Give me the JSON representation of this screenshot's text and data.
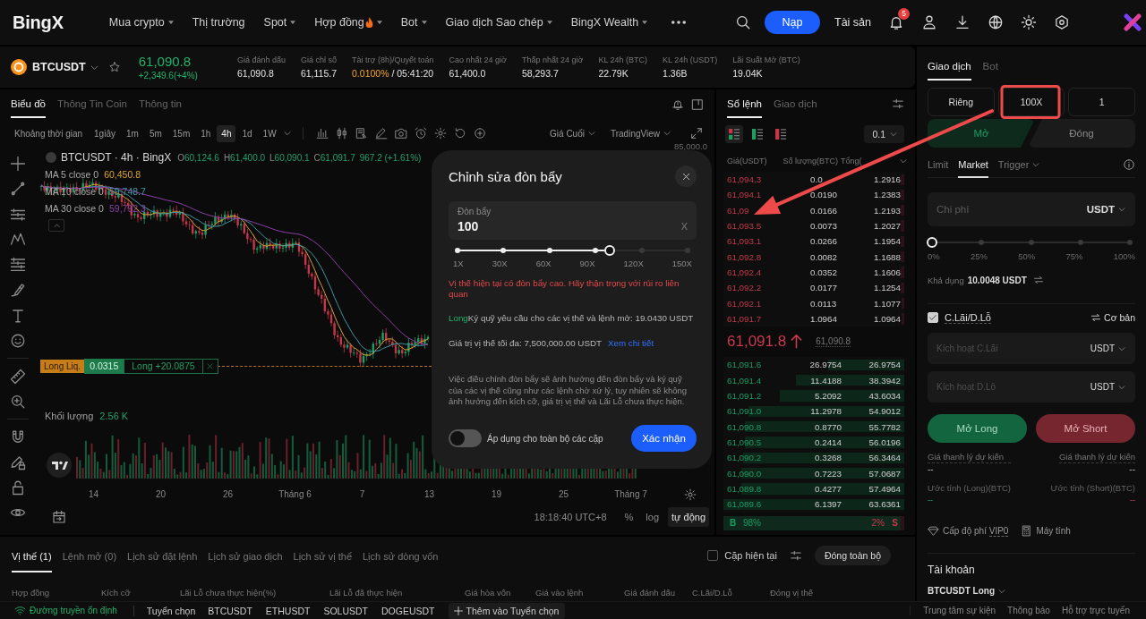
{
  "nav": {
    "logo": "BingX",
    "menu": [
      {
        "label": "Mua crypto",
        "hot": false,
        "dropdown": true
      },
      {
        "label": "Thị trường",
        "hot": false,
        "dropdown": false
      },
      {
        "label": "Spot",
        "hot": false,
        "dropdown": true
      },
      {
        "label": "Hợp đồng",
        "hot": true,
        "dropdown": true
      },
      {
        "label": "Bot",
        "hot": false,
        "dropdown": true
      },
      {
        "label": "Giao dịch Sao chép",
        "hot": false,
        "dropdown": true
      },
      {
        "label": "BingX Wealth",
        "hot": false,
        "dropdown": true
      }
    ],
    "deposit": "Nạp",
    "assets": "Tài sản",
    "notification_count": "5"
  },
  "ticker": {
    "symbol": "BTCUSDT",
    "price": "61,090.8",
    "change": "+2,349.6(+4%)",
    "rising": true,
    "stats": [
      {
        "kind": "plain",
        "label": "Giá đánh dấu",
        "value": "61,090.8"
      },
      {
        "kind": "plain",
        "label": "Giá chỉ số",
        "value": "61,115.7"
      },
      {
        "kind": "funding",
        "label": "Tài trợ (8h)/Quyết toán",
        "value": "0.0100%",
        "suffix": "/ 05:41:20"
      },
      {
        "kind": "plain",
        "label": "Cao nhất 24 giờ",
        "value": "61,400.0"
      },
      {
        "kind": "plain",
        "label": "Thấp nhất 24 giờ",
        "value": "58,293.7"
      },
      {
        "kind": "plain",
        "label": "KL 24h (BTC)",
        "value": "22.79K"
      },
      {
        "kind": "plain",
        "label": "KL 24h (USDT)",
        "value": "1.36B"
      },
      {
        "kind": "plain",
        "label": "Lãi Suất Mở (BTC)",
        "value": "19.04K"
      }
    ]
  },
  "chart": {
    "tabs": [
      {
        "label": "Biểu đồ",
        "selected": true
      },
      {
        "label": "Thông Tin Coin",
        "selected": false
      },
      {
        "label": "Thông tin",
        "selected": false
      }
    ],
    "interval_label": "Khoảng thời gian",
    "intervals": [
      {
        "label": "1giây",
        "selected": false
      },
      {
        "label": "1m",
        "selected": false
      },
      {
        "label": "5m",
        "selected": false
      },
      {
        "label": "15m",
        "selected": false
      },
      {
        "label": "1h",
        "selected": false
      },
      {
        "label": "4h",
        "selected": true
      },
      {
        "label": "1d",
        "selected": false
      },
      {
        "label": "1W",
        "selected": false
      }
    ],
    "price_source": "Giá Cuối",
    "chart_type": "TradingView",
    "price_axis_label": "85,000.0",
    "legend": {
      "title": "BTCUSDT · 4h · BingX",
      "ohlc": [
        {
          "key": "O",
          "value": "60,124.6"
        },
        {
          "key": "H",
          "value": "61,400.0"
        },
        {
          "key": "L",
          "value": "60,090.1"
        },
        {
          "key": "C",
          "value": "61,091.7"
        }
      ],
      "change": "967.2 (+1.61%)"
    },
    "moving_averages": [
      {
        "label": "MA 5 close 0",
        "value": "60,450.8",
        "color": "#d9a234"
      },
      {
        "label": "MA 10 close 0",
        "value": "59,748.7",
        "color": "#3a97a3"
      },
      {
        "label": "MA 30 close 0",
        "value": "59,792.3",
        "color": "#8c3fa6"
      }
    ],
    "position_line": {
      "liquidation": "Long Liq.",
      "size": "0.0315",
      "pnl": "Long +20.0875"
    },
    "volume": {
      "label": "Khối lượng",
      "value": "2.56 K"
    },
    "x_labels": [
      "14",
      "20",
      "26",
      "Tháng 6",
      "7",
      "13",
      "19",
      "25",
      "Tháng 7"
    ],
    "time": "18:18:40 UTC+8",
    "scales": [
      {
        "label": "%",
        "selected": false
      },
      {
        "label": "log",
        "selected": false
      },
      {
        "label": "tự động",
        "selected": true
      }
    ]
  },
  "orderbook": {
    "tabs": [
      {
        "label": "Sổ lệnh",
        "selected": true
      },
      {
        "label": "Giao dịch",
        "selected": false
      }
    ],
    "views": [
      {
        "kind": "both",
        "selected": true
      },
      {
        "kind": "bids",
        "selected": false
      },
      {
        "kind": "asks",
        "selected": false
      }
    ],
    "precision": "0.1",
    "columns": [
      {
        "label": "Giá(USDT)",
        "sortable": false
      },
      {
        "label": "Số lượng(BTC)",
        "sortable": false
      },
      {
        "label": "Tổng(",
        "sortable": true
      }
    ],
    "asks": [
      {
        "price": "61,094.3",
        "qty": "0.0",
        "total": "1.2916",
        "level": 0.02
      },
      {
        "price": "61,094.1",
        "qty": "0.0190",
        "total": "1.2383",
        "level": 0.019
      },
      {
        "price": "61,09",
        "qty": "0.0166",
        "total": "1.2193",
        "level": 0.019
      },
      {
        "price": "61,093.5",
        "qty": "0.0073",
        "total": "1.2027",
        "level": 0.019
      },
      {
        "price": "61,093.1",
        "qty": "0.0266",
        "total": "1.1954",
        "level": 0.019
      },
      {
        "price": "61,092.8",
        "qty": "0.0082",
        "total": "1.1688",
        "level": 0.018
      },
      {
        "price": "61,092.4",
        "qty": "0.0352",
        "total": "1.1606",
        "level": 0.018
      },
      {
        "price": "61,092.2",
        "qty": "0.0177",
        "total": "1.1254",
        "level": 0.018
      },
      {
        "price": "61,092.1",
        "qty": "0.0113",
        "total": "1.1077",
        "level": 0.017
      },
      {
        "price": "61,091.7",
        "qty": "1.0964",
        "total": "1.0964",
        "level": 0.017
      }
    ],
    "last": {
      "price": "61,091.8",
      "rising": true,
      "mark_price": "61,090.8"
    },
    "bids": [
      {
        "price": "61,091.6",
        "qty": "26.9754",
        "total": "26.9754",
        "level": 0.42
      },
      {
        "price": "61,091.4",
        "qty": "11.4188",
        "total": "38.3942",
        "level": 0.6
      },
      {
        "price": "61,091.2",
        "qty": "5.2092",
        "total": "43.6034",
        "level": 0.69
      },
      {
        "price": "61,091.0",
        "qty": "11.2978",
        "total": "54.9012",
        "level": 0.86
      },
      {
        "price": "61,090.8",
        "qty": "0.8770",
        "total": "55.7782",
        "level": 0.88
      },
      {
        "price": "61,090.5",
        "qty": "0.2414",
        "total": "56.0196",
        "level": 0.88
      },
      {
        "price": "61,090.2",
        "qty": "0.3268",
        "total": "56.3464",
        "level": 0.89
      },
      {
        "price": "61,090.0",
        "qty": "0.7223",
        "total": "57.0687",
        "level": 0.9
      },
      {
        "price": "61,089.8",
        "qty": "0.4277",
        "total": "57.4964",
        "level": 0.9
      },
      {
        "price": "61,089.6",
        "qty": "6.1397",
        "total": "63.6361",
        "level": 1
      }
    ],
    "ratio": {
      "buy_label": "B",
      "buy": "98%",
      "sell": "2%",
      "sell_label": "S",
      "level": 0.98
    }
  },
  "modal": {
    "title": "Chỉnh sửa đòn bẩy",
    "field_label": "Đòn bẩy",
    "value": "100",
    "unit": "X",
    "slider": {
      "level": 0.66,
      "marks": [
        "1X",
        "30X",
        "60X",
        "90X",
        "120X",
        "150X"
      ]
    },
    "warning": "Vị thế hiện tại có đòn bẩy cao. Hãy thận trọng với rủi ro liên quan",
    "margin": {
      "side": "Long",
      "text": "Ký quỹ yêu cầu cho các vị thế và lệnh mở: 19.0430 USDT"
    },
    "max_position": "Giá trị vị thế tối đa: 7,500,000.00 USDT",
    "details_link": "Xem chi tiết",
    "note": "Việc điều chỉnh đòn bẩy sẽ ảnh hưởng đến đòn bẩy và ký quỹ của các vị thế cũng như các lệnh chờ xử lý, tuy nhiên sẽ không ảnh hưởng đến kích cỡ, giá trị vị thế và Lãi Lỗ chưa thực hiện.",
    "apply_all": {
      "label": "Áp dụng cho toàn bộ các cặp",
      "on": false
    },
    "confirm": "Xác nhận"
  },
  "trade": {
    "tabs": [
      {
        "label": "Giao dịch",
        "selected": true
      },
      {
        "label": "Bot",
        "selected": false
      }
    ],
    "settings": [
      {
        "label": "Riêng"
      },
      {
        "label": "100X"
      },
      {
        "label": "1"
      }
    ],
    "sides": [
      {
        "label": "Mở",
        "selected": true
      },
      {
        "label": "Đóng",
        "selected": false
      }
    ],
    "order_types": [
      {
        "label": "Limit",
        "selected": false,
        "dropdown": false
      },
      {
        "label": "Market",
        "selected": true,
        "dropdown": false
      },
      {
        "label": "Trigger",
        "selected": false,
        "dropdown": true
      }
    ],
    "cost": {
      "placeholder": "Chi phí",
      "unit": "USDT"
    },
    "amount_slider": {
      "level": 0,
      "marks": [
        "0%",
        "25%",
        "50%",
        "75%",
        "100%"
      ]
    },
    "available": {
      "label": "Khả dụng",
      "value": "10.0048 USDT"
    },
    "tpsl": {
      "label": "C.Lãi/D.Lỗ",
      "checked": true,
      "mode": "Cơ bản",
      "fields": [
        {
          "placeholder": "Kích hoạt C.Lãi",
          "unit": "USDT"
        },
        {
          "placeholder": "Kích hoạt D.Lỗ",
          "unit": "USDT"
        }
      ]
    },
    "actions": [
      {
        "label": "Mở Long",
        "kind": "long"
      },
      {
        "label": "Mở Short",
        "kind": "short"
      }
    ],
    "estimates": [
      {
        "kind": "long",
        "liq_label": "Giá thanh lý dự kiến",
        "liq_value": "--",
        "est_label": "Ước tính (Long)(BTC)",
        "est_value": "--"
      },
      {
        "kind": "short",
        "liq_label": "Giá thanh lý dự kiến",
        "liq_value": "--",
        "est_label": "Ước tính (Short)(BTC)",
        "est_value": "--"
      }
    ],
    "fee": {
      "label": "Cấp độ phí",
      "tier": "VIP0"
    },
    "calculator": "Máy tính",
    "account": {
      "title": "Tài khoản",
      "position": "BTCUSDT Long"
    }
  },
  "positions": {
    "tabs": [
      {
        "label": "Vị thế (1)",
        "selected": true
      },
      {
        "label": "Lệnh mở (0)",
        "selected": false
      },
      {
        "label": "Lịch sử đặt lệnh",
        "selected": false
      },
      {
        "label": "Lịch sử giao dịch",
        "selected": false
      },
      {
        "label": "Lịch sử vị thế",
        "selected": false
      },
      {
        "label": "Lịch sử dòng vốn",
        "selected": false
      }
    ],
    "current_pair": {
      "label": "Cặp hiện tại",
      "checked": false
    },
    "close_all": "Đóng toàn bộ",
    "columns": [
      "Hợp đồng",
      "Kích cỡ",
      "Lãi Lỗ chưa thực hiện(%)",
      "Lãi Lỗ đã thực hiện",
      "Giá hòa vốn",
      "Giá vào lệnh",
      "Giá đánh dấu",
      "C.Lãi/D.Lỗ",
      "Đóng vị thế"
    ]
  },
  "status_bar": {
    "connection": "Đường truyền ổn định",
    "favorites_label": "Tuyển chọn",
    "favorites": [
      "BTCUSDT",
      "ETHUSDT",
      "SOLUSDT",
      "DOGEUSDT"
    ],
    "add": "Thêm vào Tuyển chọn",
    "links": [
      "Trung tâm sự kiện",
      "Thông báo",
      "Hỗ trợ trực tuyến"
    ]
  },
  "annotations": {
    "arrow": true,
    "highlight_frame": true
  }
}
